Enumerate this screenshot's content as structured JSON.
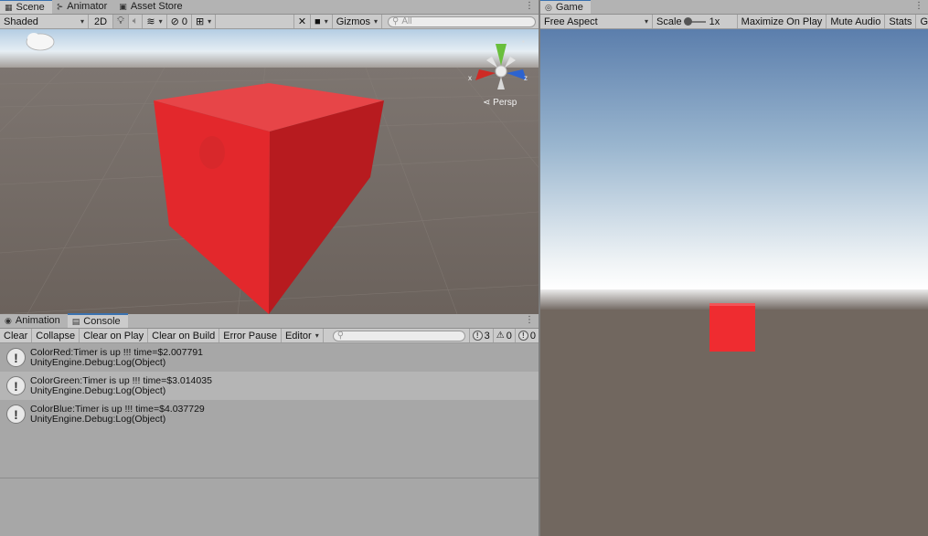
{
  "scene_panel": {
    "tabs": [
      {
        "label": "Scene",
        "icon": "grid-icon",
        "active": true
      },
      {
        "label": "Animator",
        "icon": "animator-icon",
        "active": false
      },
      {
        "label": "Asset Store",
        "icon": "store-icon",
        "active": false
      }
    ],
    "toolbar": {
      "draw_mode": "Shaded",
      "mode_2d": "2D",
      "hidden_count": "0",
      "gizmos_label": "Gizmos",
      "search_placeholder": "All"
    },
    "view": {
      "projection_label": "Persp",
      "gizmo_axis_x": "x",
      "gizmo_axis_z": "z",
      "cube_color": "#e32b2f"
    }
  },
  "console_panel": {
    "tabs": [
      {
        "label": "Animation",
        "icon": "animation-icon",
        "active": false
      },
      {
        "label": "Console",
        "icon": "console-icon",
        "active": true
      }
    ],
    "toolbar": {
      "clear": "Clear",
      "collapse": "Collapse",
      "clear_on_play": "Clear on Play",
      "clear_on_build": "Clear on Build",
      "error_pause": "Error Pause",
      "editor": "Editor",
      "search_placeholder": "",
      "log_count": "3",
      "warning_count": "0",
      "error_count": "0"
    },
    "logs": [
      {
        "message": "ColorRed:Timer is up !!! time=$2.007791",
        "trace": "UnityEngine.Debug:Log(Object)"
      },
      {
        "message": "ColorGreen:Timer is up !!! time=$3.014035",
        "trace": "UnityEngine.Debug:Log(Object)"
      },
      {
        "message": "ColorBlue:Timer is up !!! time=$4.037729",
        "trace": "UnityEngine.Debug:Log(Object)"
      }
    ]
  },
  "game_panel": {
    "tab_label": "Game",
    "toolbar": {
      "aspect": "Free Aspect",
      "scale_label": "Scale",
      "scale_value": "1x",
      "maximize_on_play": "Maximize On Play",
      "mute_audio": "Mute Audio",
      "stats": "Stats",
      "gizmos_truncated": "G"
    },
    "cube_color": "#ef2c30"
  },
  "colors": {
    "accent": "#3a72b0",
    "panel_bg": "#cbcbcb",
    "tab_bar_bg": "#b3b3b3"
  }
}
